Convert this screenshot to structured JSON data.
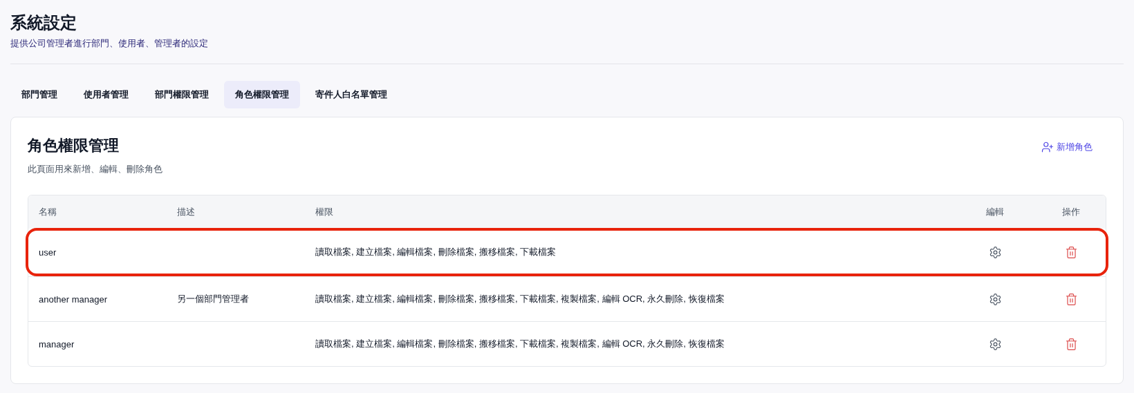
{
  "header": {
    "title": "系統設定",
    "subtitle": "提供公司管理者進行部門、使用者、管理者的設定"
  },
  "tabs": [
    {
      "label": "部門管理",
      "selected": false
    },
    {
      "label": "使用者管理",
      "selected": false
    },
    {
      "label": "部門權限管理",
      "selected": false
    },
    {
      "label": "角色權限管理",
      "selected": true
    },
    {
      "label": "寄件人白名單管理",
      "selected": false
    }
  ],
  "card": {
    "title": "角色權限管理",
    "subtitle": "此頁面用來新增、編輯、刪除角色",
    "add_button": "新增角色"
  },
  "table": {
    "columns": [
      "名稱",
      "描述",
      "權限",
      "編輯",
      "操作"
    ],
    "rows": [
      {
        "name": "user",
        "description": "",
        "permissions": "讀取檔案, 建立檔案, 編輯檔案, 刪除檔案, 搬移檔案, 下載檔案",
        "highlighted": true
      },
      {
        "name": "another manager",
        "description": "另一個部門管理者",
        "permissions": "讀取檔案, 建立檔案, 編輯檔案, 刪除檔案, 搬移檔案, 下載檔案, 複製檔案, 編輯 OCR, 永久刪除, 恢復檔案",
        "highlighted": false
      },
      {
        "name": "manager",
        "description": "",
        "permissions": "讀取檔案, 建立檔案, 編輯檔案, 刪除檔案, 搬移檔案, 下載檔案, 複製檔案, 編輯 OCR, 永久刪除, 恢復檔案",
        "highlighted": false
      }
    ]
  }
}
